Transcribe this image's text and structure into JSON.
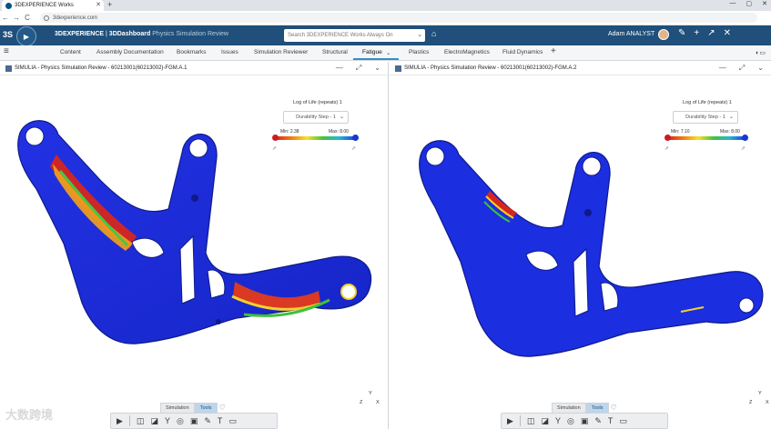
{
  "browser": {
    "tab_title": "3DEXPERIENCE Works",
    "tab_close": "✕",
    "new_tab": "+",
    "url": "3dexperience.com",
    "back": "←",
    "forward": "→",
    "reload": "C",
    "window_buttons": [
      "—",
      "▢",
      "✕"
    ]
  },
  "topbar": {
    "brand": "3DEXPERIENCE",
    "separator": " | ",
    "app": "3DDashboard",
    "dashboard_name": "Physics Simulation Review",
    "search_placeholder": "Search 3DEXPERIENCE Works Always On",
    "user_name": "Adam ANALYST",
    "icons": [
      "bookmark-icon",
      "plus-icon",
      "share-icon",
      "tools-icon"
    ]
  },
  "tabs": {
    "items": [
      "Content",
      "Assembly Documentation",
      "Bookmarks",
      "Issues",
      "Simulation Reviewer",
      "Structural",
      "Fatigue",
      "Plastics",
      "ElectroMagnetics",
      "Fluid Dynamics"
    ],
    "active": "Fatigue",
    "add": "+"
  },
  "panels": [
    {
      "title": "SIMULIA - Physics Simulation Review - 60213001(60213002)-FGM.A.1",
      "legend_title": "Log of Life (repeats) 1",
      "dropdown": "Durability Step - 1",
      "min_label": "Min: 2.38",
      "max_label": "Max: 8.00",
      "bottom_tabs": [
        "Simulation",
        "Tools"
      ],
      "active_bottom_tab": "Tools"
    },
    {
      "title": "SIMULIA - Physics Simulation Review - 60213001(60213002)-FGM.A.2",
      "legend_title": "Log of Life (repeats) 1",
      "dropdown": "Durability Step - 1",
      "min_label": "Min: 7.10",
      "max_label": "Max: 8.00",
      "bottom_tabs": [
        "Simulation",
        "Tools"
      ],
      "active_bottom_tab": "Tools"
    }
  ],
  "axes": {
    "x": "X",
    "y": "Y",
    "z": "Z"
  },
  "colors": {
    "topbar": "#1f4f7a",
    "active_tab": "#368ec4",
    "model_blue": "#1b2ee0",
    "stress_red": "#d7261d"
  },
  "watermark": "大数跨境"
}
